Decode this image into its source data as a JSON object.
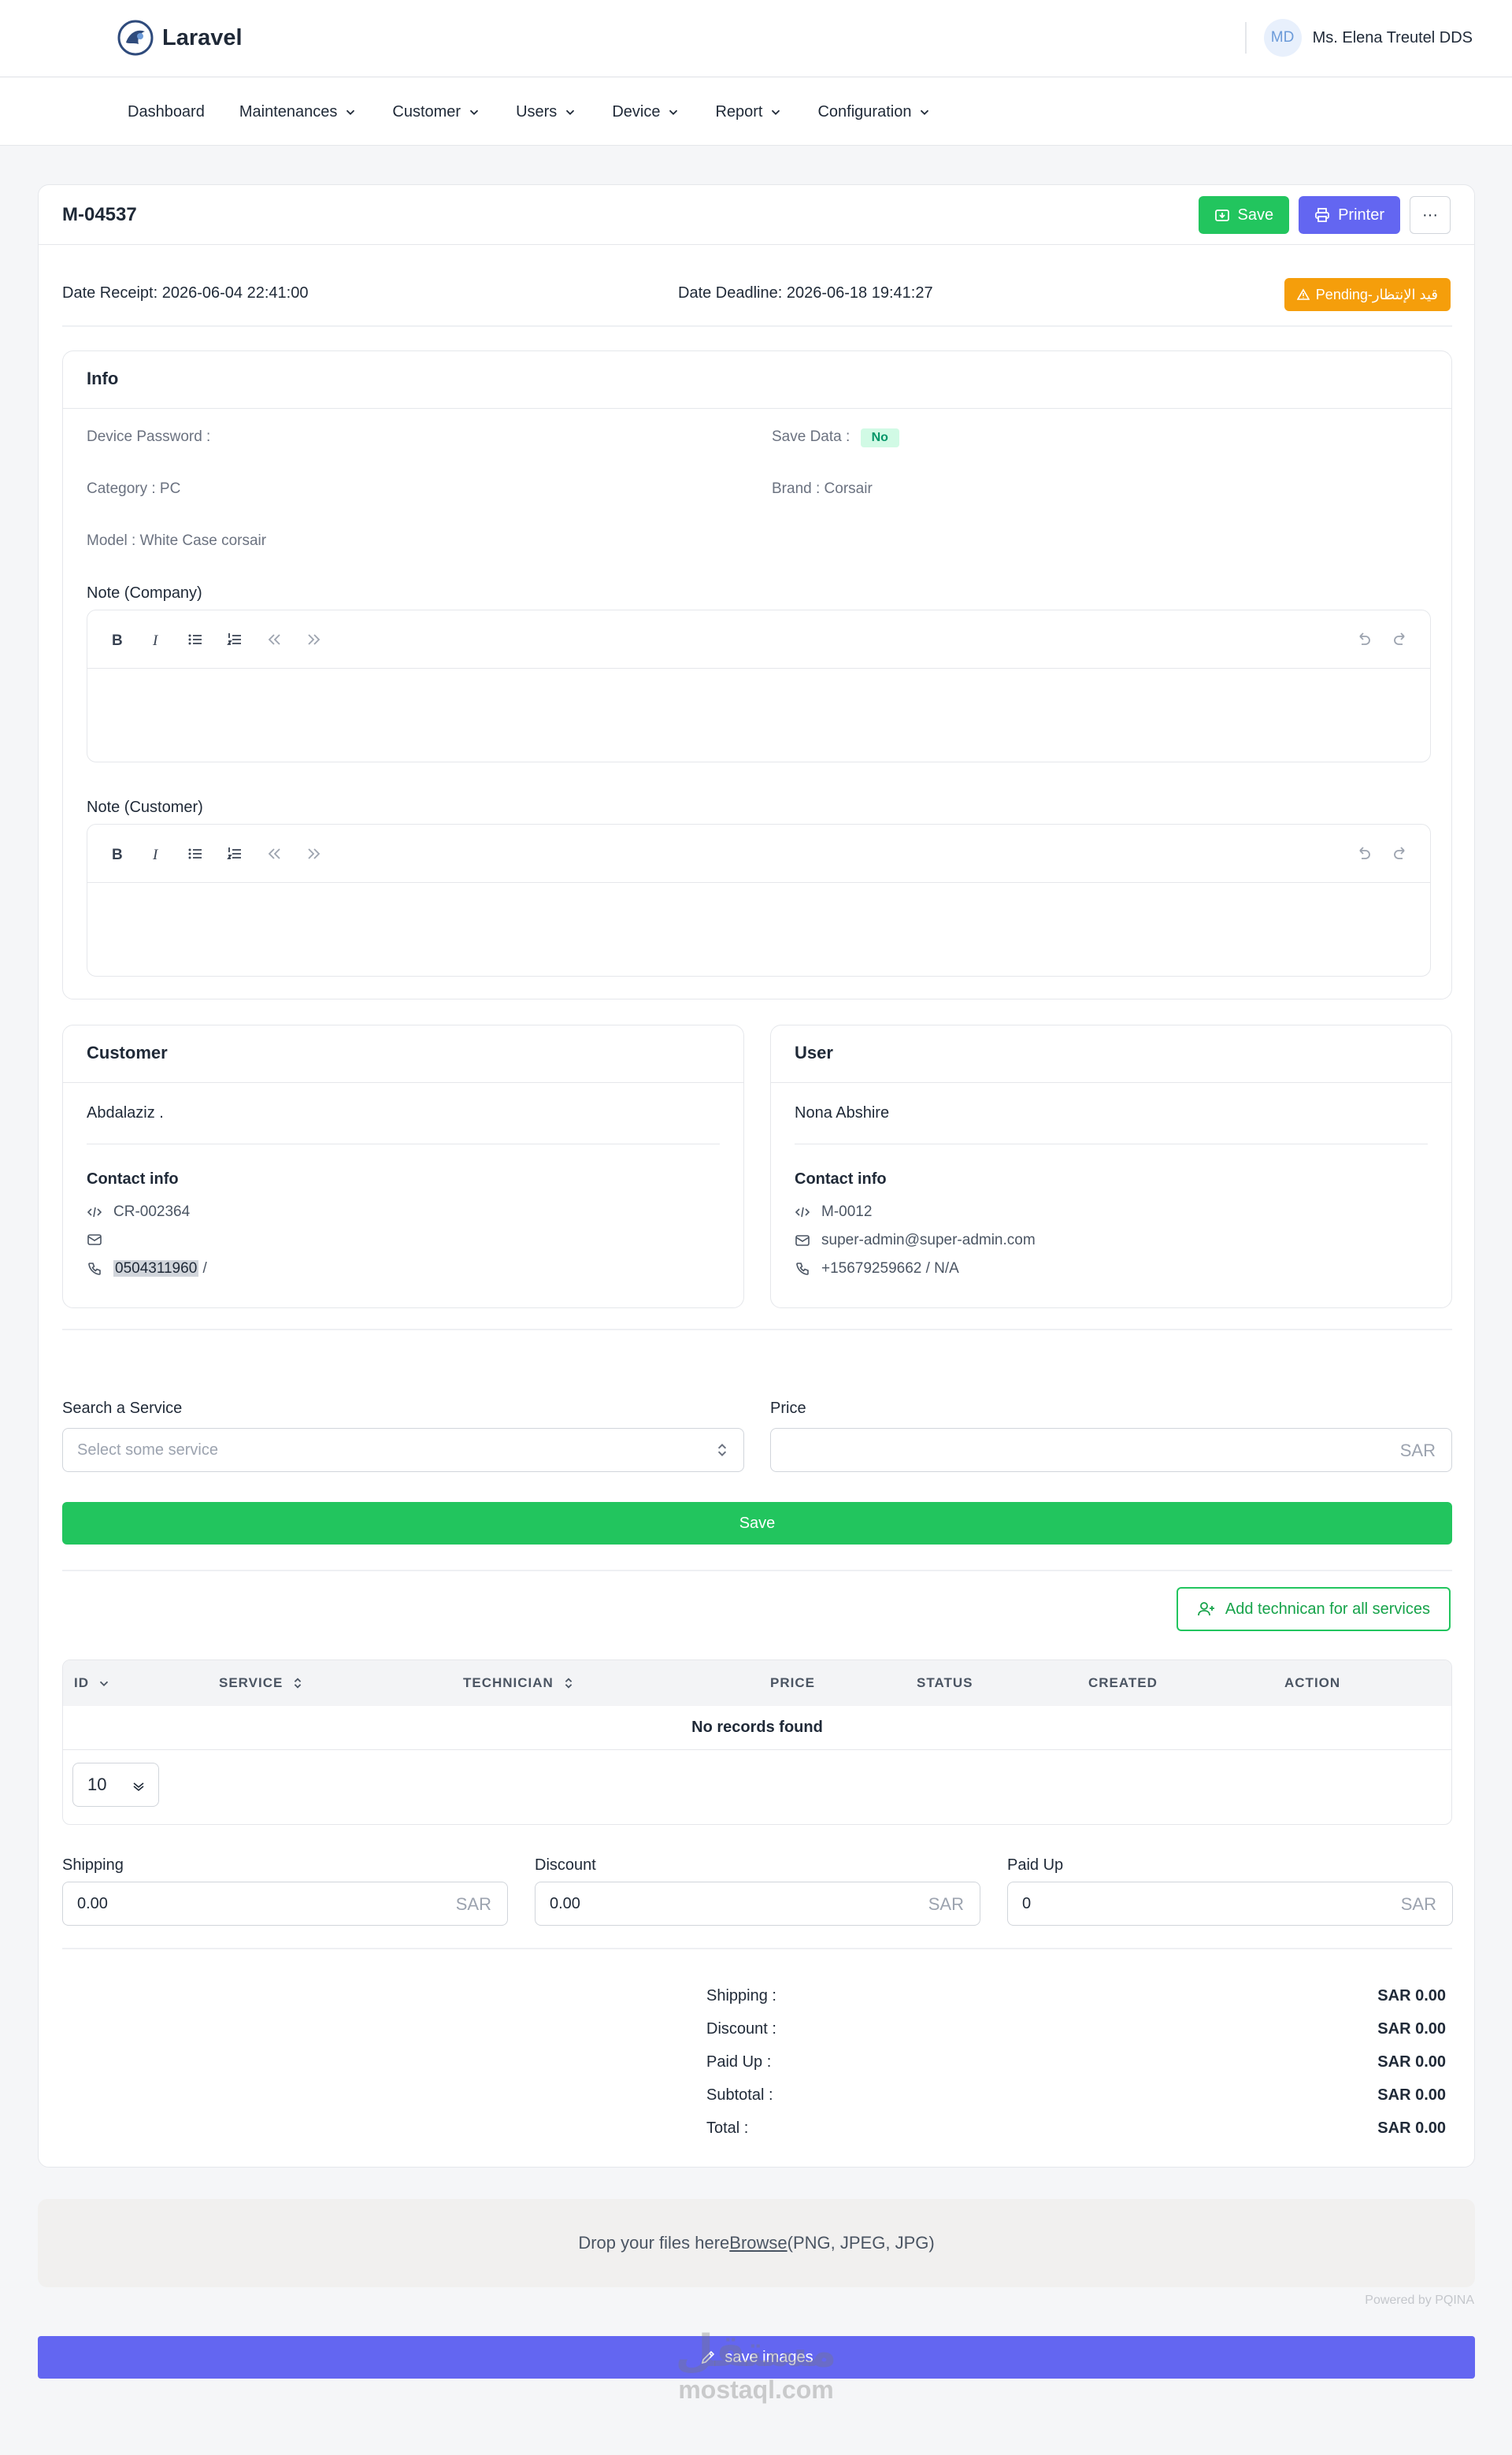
{
  "app": {
    "brand": "Laravel",
    "user_initials": "MD",
    "user_name": "Ms. Elena Treutel DDS"
  },
  "nav": [
    "Dashboard",
    "Maintenances",
    "Customer",
    "Users",
    "Device",
    "Report",
    "Configuration"
  ],
  "order": {
    "id": "M-04537",
    "save_label": "Save",
    "printer_label": "Printer",
    "more_label": "···",
    "date_receipt": "Date Receipt: 2026-06-04 22:41:00",
    "date_deadline": "Date Deadline: 2026-06-18 19:41:27",
    "status": "Pending-قيد الإنتظار",
    "status_color": "#f59e0b"
  },
  "info": {
    "title": "Info",
    "device_password": "Device Password :",
    "save_data_label": "Save Data :",
    "save_data_value": "No",
    "category": "Category : PC",
    "brand": "Brand : Corsair",
    "model": "Model : White Case corsair",
    "note_company_label": "Note (Company)",
    "note_customer_label": "Note (Customer)"
  },
  "customer": {
    "title": "Customer",
    "name": "Abdalaziz .",
    "contact_title": "Contact info",
    "code": "CR-002364",
    "email": "",
    "phone": "0504311960",
    "phone_suffix": " /"
  },
  "user": {
    "title": "User",
    "name": "Nona Abshire",
    "contact_title": "Contact info",
    "code": "M-0012",
    "email": "super-admin@super-admin.com",
    "phone": "+15679259662 / N/A"
  },
  "service_form": {
    "search_label": "Search a Service",
    "search_placeholder": "Select some service",
    "price_label": "Price",
    "currency": "SAR",
    "save_label": "Save",
    "add_technician_label": "Add technican for all services"
  },
  "table": {
    "columns": [
      "ID",
      "SERVICE",
      "TECHNICIAN",
      "PRICE",
      "STATUS",
      "CREATED",
      "ACTION"
    ],
    "empty_text": "No records found",
    "per_page": "10"
  },
  "charges": {
    "shipping_label": "Shipping",
    "shipping_value": "0.00",
    "discount_label": "Discount",
    "discount_value": "0.00",
    "paid_up_label": "Paid Up",
    "paid_up_value": "0",
    "currency": "SAR"
  },
  "summary": [
    {
      "label": "Shipping :",
      "value": "SAR 0.00"
    },
    {
      "label": "Discount :",
      "value": "SAR 0.00"
    },
    {
      "label": "Paid Up :",
      "value": "SAR 0.00"
    },
    {
      "label": "Subtotal :",
      "value": "SAR 0.00"
    },
    {
      "label": "Total :",
      "value": "SAR 0.00"
    }
  ],
  "upload": {
    "drop_text": "Drop your files here ",
    "browse": "Browse",
    "types": " (PNG, JPEG, JPG)",
    "powered": "Powered by PQINA",
    "save_images": "save images"
  },
  "watermark": {
    "arabic": "مستقل",
    "latin": "mostaql.com"
  }
}
